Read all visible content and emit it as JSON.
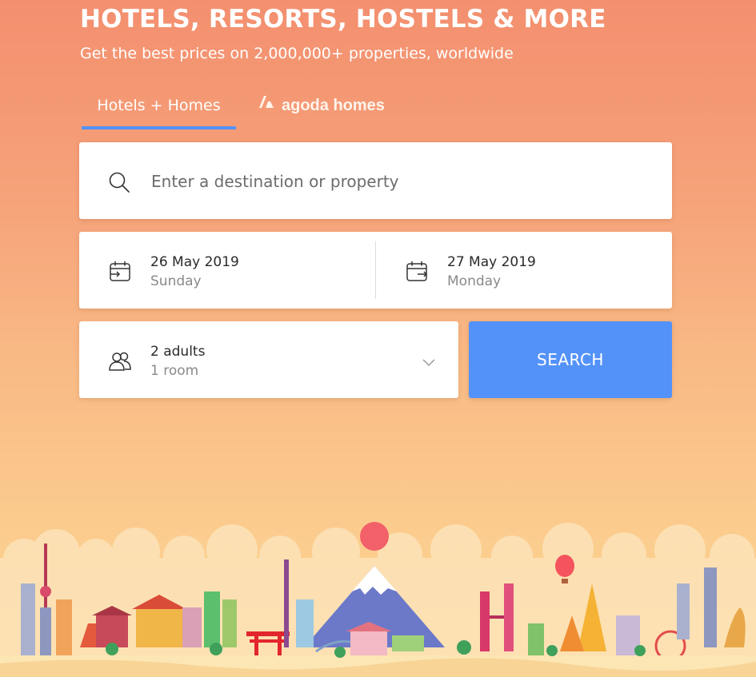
{
  "hero": {
    "title": "HOTELS, RESORTS, HOSTELS & MORE",
    "subtitle": "Get the best prices on 2,000,000+ properties, worldwide"
  },
  "tabs": [
    {
      "label": "Hotels + Homes",
      "active": true
    },
    {
      "label": "agoda homes",
      "active": false
    }
  ],
  "search": {
    "placeholder": "Enter a destination or property",
    "value": ""
  },
  "check_in": {
    "date": "26 May 2019",
    "day": "Sunday"
  },
  "check_out": {
    "date": "27 May 2019",
    "day": "Monday"
  },
  "occupancy": {
    "guests": "2 adults",
    "rooms": "1 room"
  },
  "search_button": {
    "label": "SEARCH"
  },
  "colors": {
    "accent": "#5392f9",
    "background_top": "#f38f6f",
    "background_bottom": "#fbd591"
  },
  "icons": {
    "search": "search-icon",
    "check_in": "calendar-check-in-icon",
    "check_out": "calendar-check-out-icon",
    "guests": "guests-icon",
    "dropdown": "chevron-down-icon",
    "homes_logo": "agoda-homes-logo-icon"
  }
}
